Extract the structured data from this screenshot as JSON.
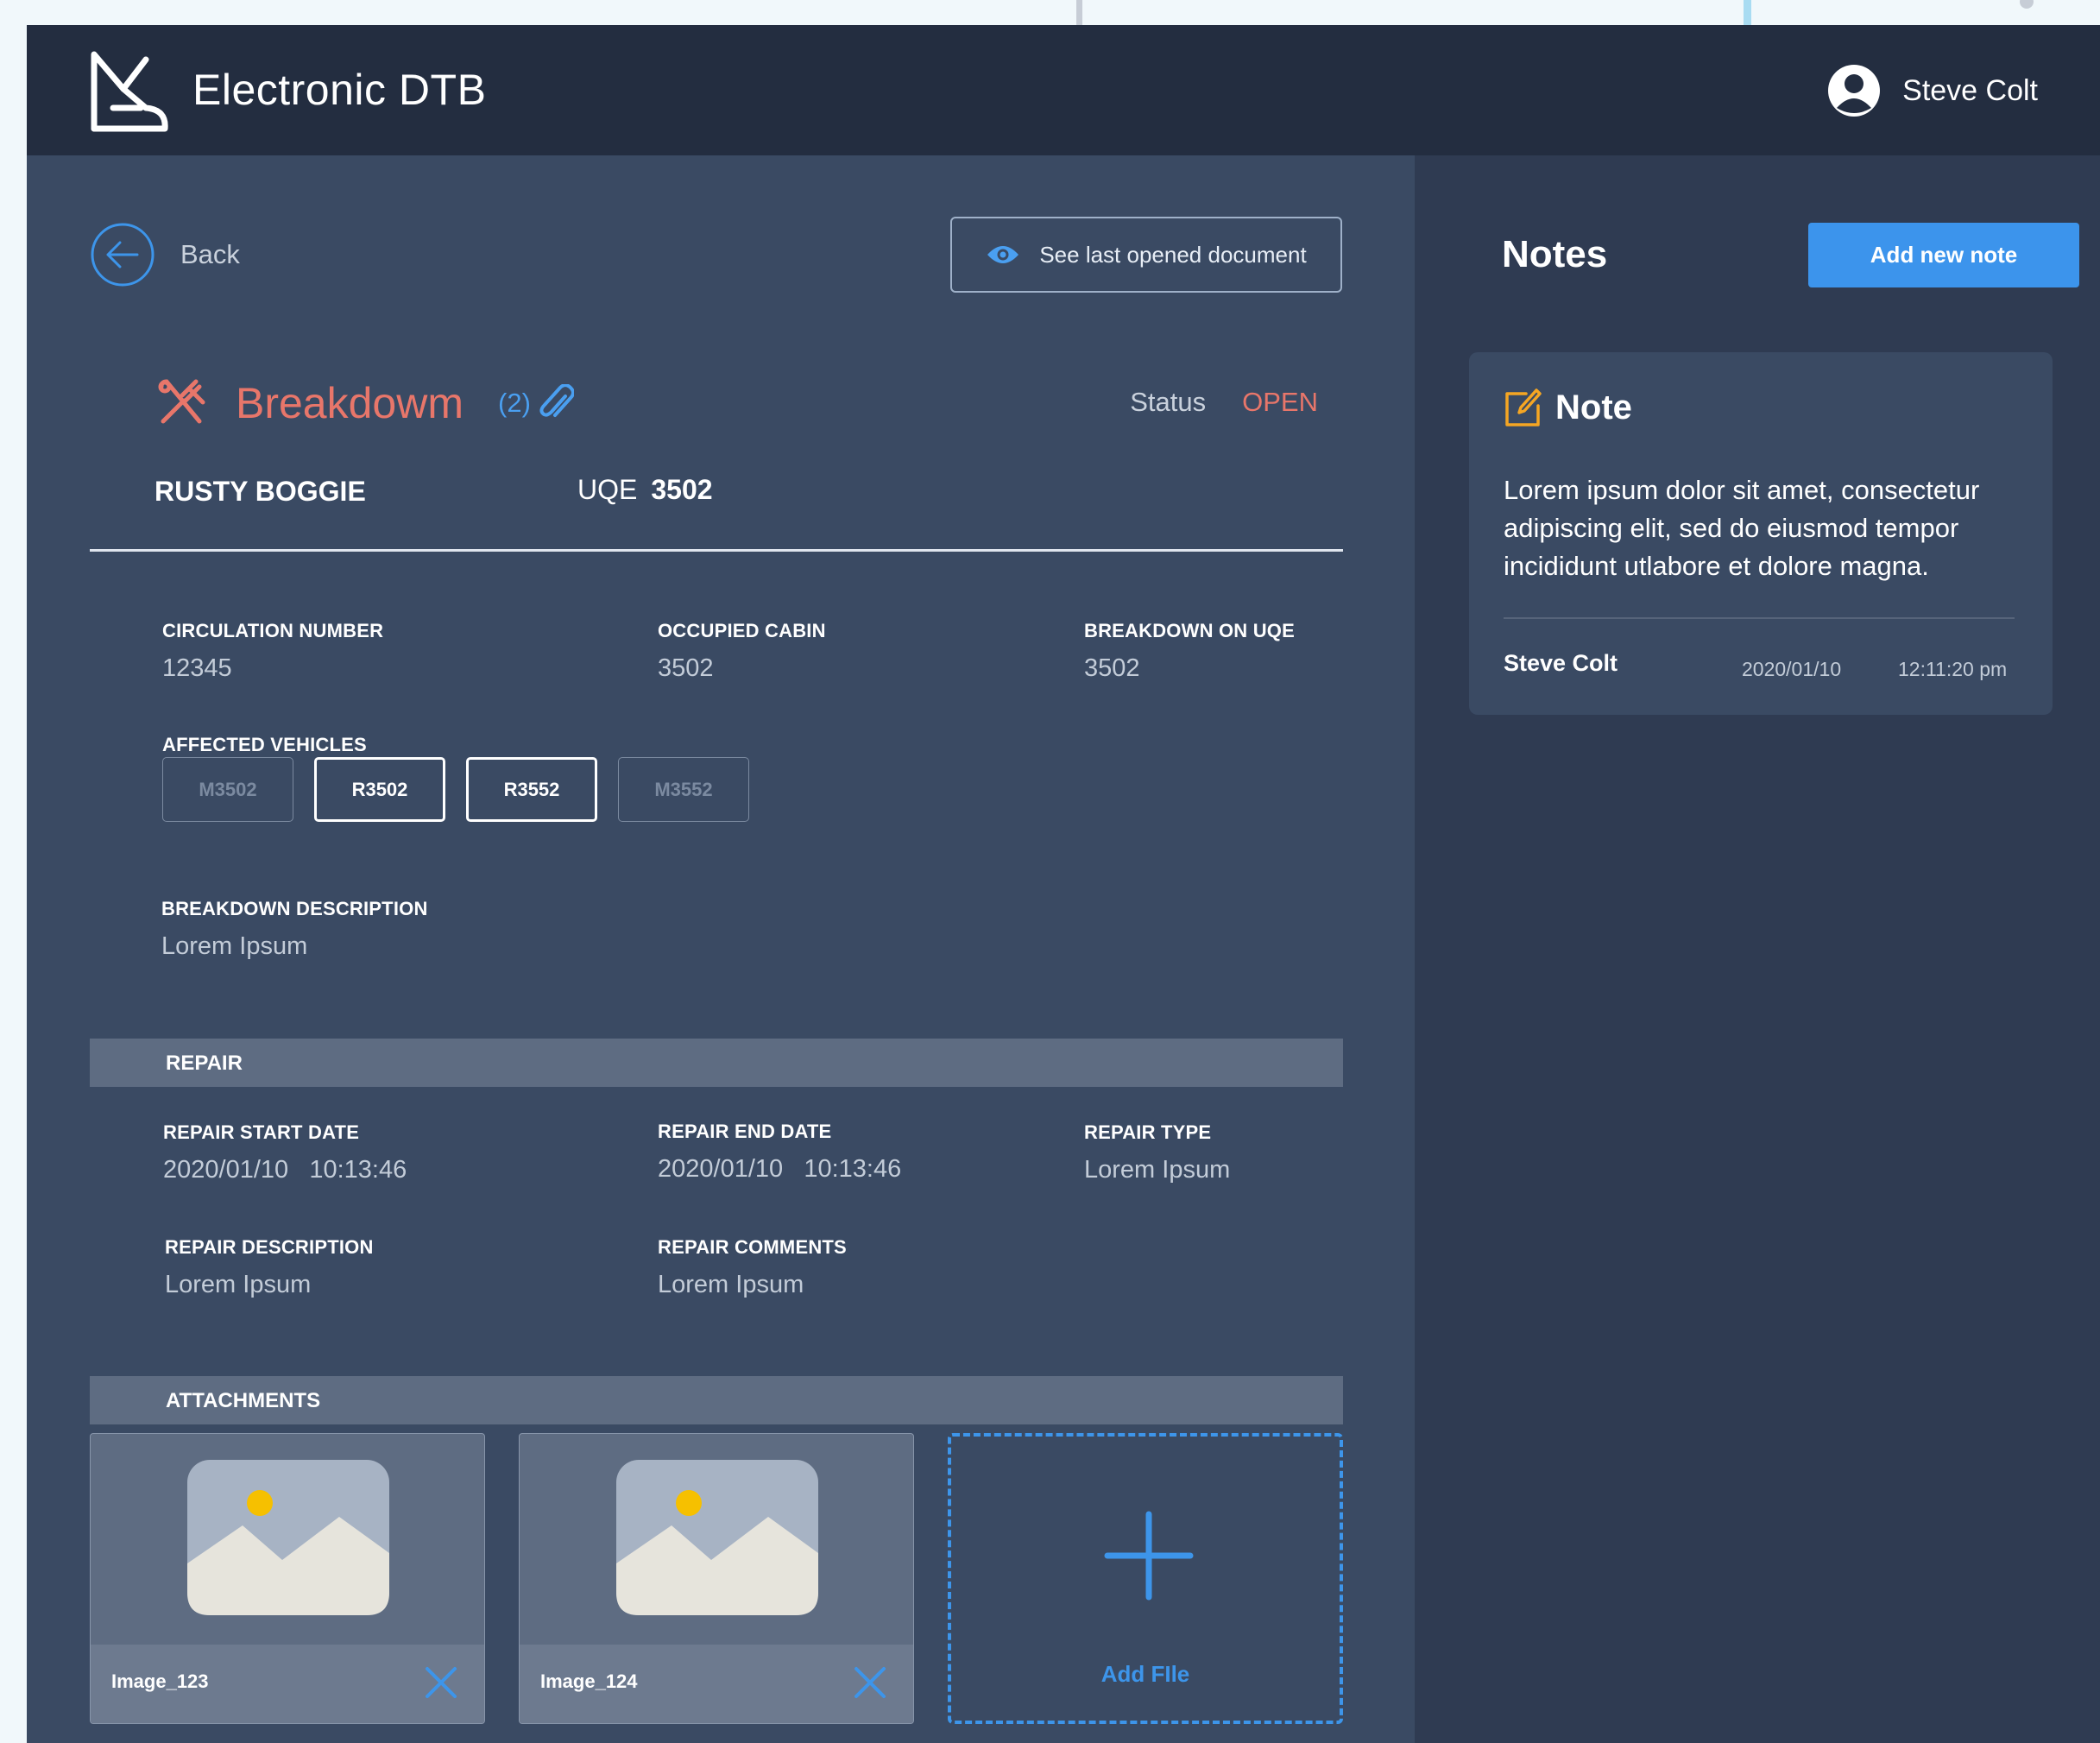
{
  "colors": {
    "page_bg": "#f1f8fb",
    "topbar": "#232d40",
    "main_panel": "#3a4a63",
    "side_panel": "#2f3b52",
    "accent_blue": "#3c94ec",
    "breakdown_red": "#e8766a",
    "note_icon_orange": "#f5a623"
  },
  "header": {
    "app_title": "Electronic DTB",
    "logo_icon": "train-logo-icon",
    "user_icon": "user-avatar-icon",
    "user_name": "Steve Colt"
  },
  "toolbar": {
    "back_label": "Back",
    "last_doc_label": "See last opened document",
    "last_doc_icon": "eye-icon"
  },
  "record": {
    "type_icon": "tools-icon",
    "type": "Breakdowm",
    "attachment_count": "(2)",
    "attachment_icon": "paperclip-icon",
    "status_label": "Status",
    "status_value": "OPEN",
    "vehicle_name": "RUSTY BOGGIE",
    "uqe_label": "UQE",
    "uqe_value": "3502"
  },
  "details": {
    "circulation_number_label": "CIRCULATION NUMBER",
    "circulation_number": "12345",
    "occupied_cabin_label": "OCCUPIED CABIN",
    "occupied_cabin": "3502",
    "breakdown_on_uqe_label": "BREAKDOWN ON UQE",
    "breakdown_on_uqe": "3502",
    "affected_vehicles_label": "AFFECTED VEHICLES",
    "affected_vehicles": [
      {
        "label": "M3502",
        "selected": false
      },
      {
        "label": "R3502",
        "selected": true
      },
      {
        "label": "R3552",
        "selected": true
      },
      {
        "label": "M3552",
        "selected": false
      }
    ],
    "breakdown_description_label": "BREAKDOWN DESCRIPTION",
    "breakdown_description": "Lorem Ipsum"
  },
  "repair": {
    "section_title": "REPAIR",
    "start_date_label": "REPAIR START DATE",
    "start_date": "2020/01/10   10:13:46",
    "end_date_label": "REPAIR END DATE",
    "end_date": "2020/01/10   10:13:46",
    "type_label": "REPAIR TYPE",
    "type": "Lorem Ipsum",
    "description_label": "REPAIR DESCRIPTION",
    "description": "Lorem Ipsum",
    "comments_label": "REPAIR COMMENTS",
    "comments": "Lorem Ipsum"
  },
  "attachments": {
    "section_title": "ATTACHMENTS",
    "files": [
      {
        "name": "Image_123",
        "icon": "image-placeholder-icon",
        "remove_icon": "close-icon"
      },
      {
        "name": "Image_124",
        "icon": "image-placeholder-icon",
        "remove_icon": "close-icon"
      }
    ],
    "add_label": "Add FIle",
    "add_icon": "plus-icon"
  },
  "notes": {
    "title": "Notes",
    "add_button": "Add new note",
    "items": [
      {
        "icon": "edit-note-icon",
        "heading": "Note",
        "body": "Lorem ipsum dolor sit amet, consectetur adipiscing elit, sed do eiusmod tempor incididunt utlabore et dolore magna.",
        "author": "Steve Colt",
        "date": "2020/01/10",
        "time": "12:11:20 pm"
      }
    ]
  }
}
